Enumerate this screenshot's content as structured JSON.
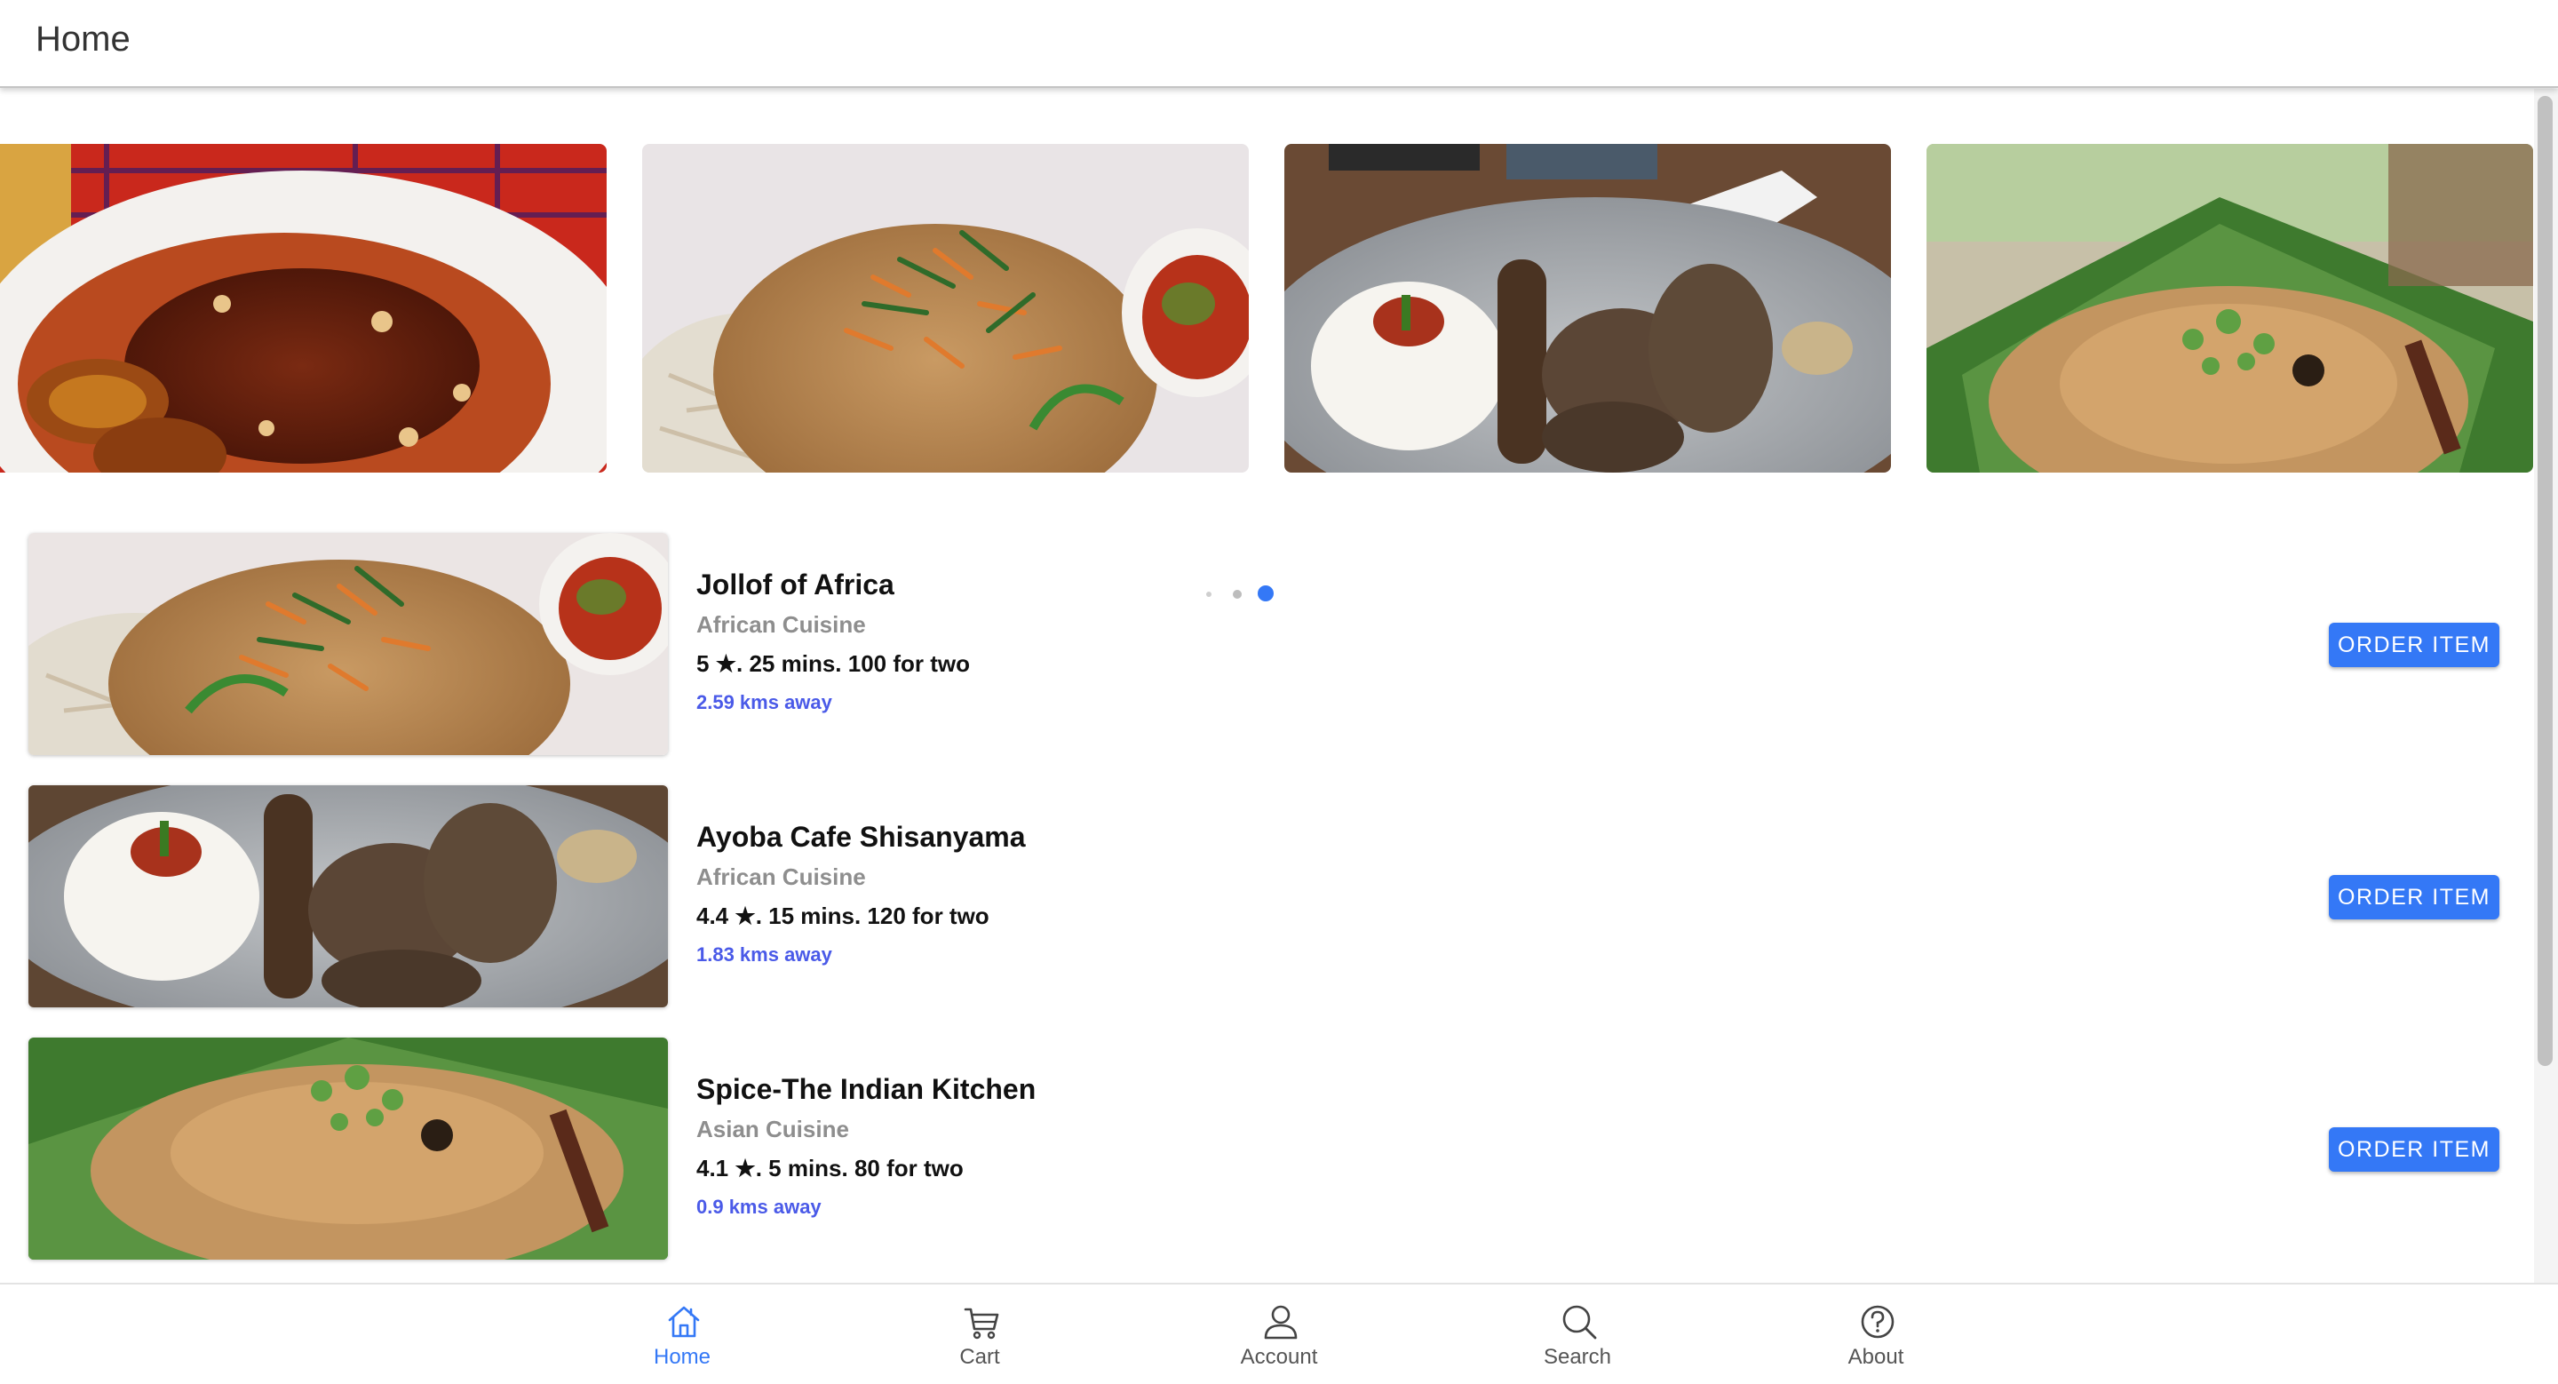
{
  "header": {
    "title": "Home"
  },
  "carousel": {
    "slides": [
      {
        "image": "plate-of-stew-with-plantains"
      },
      {
        "image": "jollof-rice-with-sauce"
      },
      {
        "image": "grilled-meats-with-pap"
      },
      {
        "image": "spiced-rice-on-banana-leaf"
      }
    ],
    "active_index": 2,
    "dot_count": 3
  },
  "restaurants": [
    {
      "name": "Jollof of Africa",
      "cuisine": "African Cuisine",
      "rating": "5",
      "meta_suffix": ". 25 mins. 100 for two",
      "distance": "2.59 kms away",
      "button": "ORDER ITEM",
      "image": "jollof-rice-with-sauce"
    },
    {
      "name": "Ayoba Cafe Shisanyama",
      "cuisine": "African Cuisine",
      "rating": "4.4",
      "meta_suffix": ". 15 mins. 120 for two",
      "distance": "1.83 kms away",
      "button": "ORDER ITEM",
      "image": "grilled-meats-with-pap"
    },
    {
      "name": "Spice-The Indian Kitchen",
      "cuisine": "Asian Cuisine",
      "rating": "4.1",
      "meta_suffix": ". 5 mins. 80 for two",
      "distance": "0.9 kms away",
      "button": "ORDER ITEM",
      "image": "spiced-rice-on-banana-leaf"
    }
  ],
  "tabbar": {
    "tabs": [
      {
        "label": "Home",
        "icon": "home-icon",
        "active": true
      },
      {
        "label": "Cart",
        "icon": "cart-icon",
        "active": false
      },
      {
        "label": "Account",
        "icon": "account-icon",
        "active": false
      },
      {
        "label": "Search",
        "icon": "search-icon",
        "active": false
      },
      {
        "label": "About",
        "icon": "help-icon",
        "active": false
      }
    ]
  },
  "colors": {
    "accent": "#3478f6",
    "distance": "#4a5ae8",
    "muted": "#8e8e8e"
  }
}
